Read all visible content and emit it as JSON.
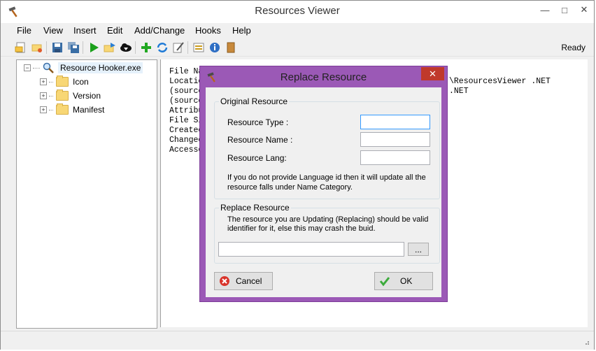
{
  "app": {
    "title": "Resources Viewer",
    "status": "Ready"
  },
  "menu": [
    "File",
    "View",
    "Insert",
    "Edit",
    "Add/Change",
    "Hooks",
    "Help"
  ],
  "tree": {
    "root": "Resource Hooker.exe",
    "children": [
      "Icon",
      "Version",
      "Manifest"
    ]
  },
  "details": {
    "lines": [
      "File Na",
      "Locatic",
      "(source",
      "(source",
      "Attribu",
      "File Si",
      "Createc",
      "Changec",
      "Accesse"
    ],
    "right_fragments": [
      "\\ResourcesViewer .NET",
      ".NET"
    ]
  },
  "dialog": {
    "title": "Replace Resource",
    "original_group": "Original Resource",
    "resource_type_label": "Resource Type :",
    "resource_name_label": "Resource Name :",
    "resource_lang_label": "Resource Lang:",
    "hint_line1": "If you do not provide Language id then it will update all the",
    "hint_line2": "resource falls under Name Category.",
    "replace_group": "Replace Resource",
    "replace_hint_line1": "The resource you are Updating (Replacing) should be valid",
    "replace_hint_line2": "identifier for it, else this may crash the buid.",
    "browse_label": "...",
    "cancel_label": "Cancel",
    "ok_label": "OK"
  },
  "colors": {
    "dialog_frame": "#9b59b6",
    "close_button": "#c0392b",
    "focus": "#3399ff"
  }
}
